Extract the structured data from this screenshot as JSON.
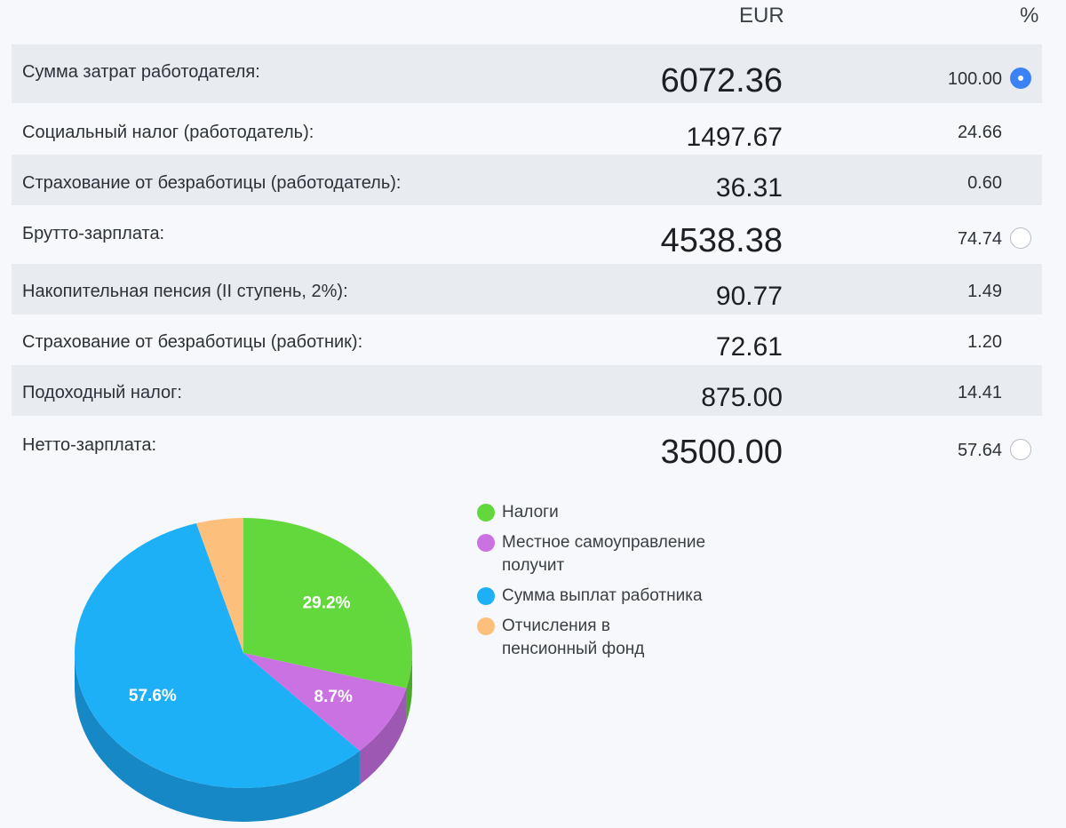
{
  "header": {
    "currency": "EUR",
    "percent": "%"
  },
  "rows": [
    {
      "label": "Сумма затрат работодателя:",
      "eur": "6072.36",
      "pct": "100.00",
      "radio": "selected"
    },
    {
      "label": "Социальный налог (работодатель):",
      "eur": "1497.67",
      "pct": "24.66",
      "radio": "none"
    },
    {
      "label": "Страхование от безработицы (работодатель):",
      "eur": "36.31",
      "pct": "0.60",
      "radio": "none"
    },
    {
      "label": "Брутто-зарплата:",
      "eur": "4538.38",
      "pct": "74.74",
      "radio": "unselected"
    },
    {
      "label": "Накопительная пенсия (II ступень, 2%):",
      "eur": "90.77",
      "pct": "1.49",
      "radio": "none"
    },
    {
      "label": "Страхование от безработицы (работник):",
      "eur": "72.61",
      "pct": "1.20",
      "radio": "none"
    },
    {
      "label": "Подоходный налог:",
      "eur": "875.00",
      "pct": "14.41",
      "radio": "none"
    },
    {
      "label": "Нетто-зарплата:",
      "eur": "3500.00",
      "pct": "57.64",
      "radio": "unselected"
    }
  ],
  "chart_data": {
    "type": "pie",
    "categories": [
      "Налоги",
      "Местное самоуправление получит",
      "Сумма выплат работника",
      "Отчисления в пенсионный фонд"
    ],
    "values": [
      29.2,
      8.7,
      57.6,
      4.5
    ],
    "data_labels": [
      "29.2%",
      "8.7%",
      "57.6%",
      ""
    ],
    "colors": [
      "#62d83c",
      "#cb72e3",
      "#1eb0f7",
      "#fcc07c"
    ],
    "side_colors": [
      "#4aa82d",
      "#9c58b2",
      "#1788c6",
      "#d89d5c"
    ],
    "legend_position": "right",
    "style": "3d"
  },
  "colors": {
    "accent": "#3b82f6",
    "shaded_row": "#e8ebf0",
    "background": "#f6f8fb"
  }
}
